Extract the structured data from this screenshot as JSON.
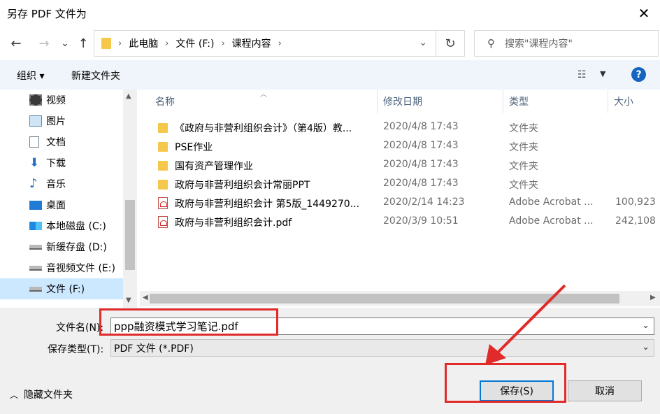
{
  "window": {
    "title": "另存 PDF 文件为",
    "close_symbol": "✕"
  },
  "nav": {
    "back_symbol": "←",
    "forward_symbol": "→",
    "recent_symbol": "⌄",
    "up_symbol": "↑",
    "breadcrumbs": [
      "此电脑",
      "文件 (F:)",
      "课程内容"
    ],
    "crumb_separator": "›",
    "refresh_symbol": "↻",
    "search_placeholder": "搜索\"课程内容\""
  },
  "toolbar": {
    "organize": "组织 ▾",
    "new_folder": "新建文件夹",
    "help": "?"
  },
  "sidebar": {
    "items": [
      {
        "label": "视频",
        "icon": "video-icon"
      },
      {
        "label": "图片",
        "icon": "pictures-icon"
      },
      {
        "label": "文档",
        "icon": "documents-icon"
      },
      {
        "label": "下载",
        "icon": "download-icon"
      },
      {
        "label": "音乐",
        "icon": "music-icon"
      },
      {
        "label": "桌面",
        "icon": "desktop-icon"
      },
      {
        "label": "本地磁盘 (C:)",
        "icon": "windows-drive-icon"
      },
      {
        "label": "新缓存盘 (D:)",
        "icon": "drive-icon"
      },
      {
        "label": "音视频文件 (E:)",
        "icon": "drive-icon"
      },
      {
        "label": "文件 (F:)",
        "icon": "drive-icon",
        "selected": true
      }
    ]
  },
  "columns": {
    "name": "名称",
    "date": "修改日期",
    "type": "类型",
    "size": "大小"
  },
  "files": [
    {
      "name": "《政府与非营利组织会计》（第4版）教...",
      "date": "2020/4/8 17:43",
      "type": "文件夹",
      "size": "",
      "kind": "folder"
    },
    {
      "name": "PSE作业",
      "date": "2020/4/8 17:43",
      "type": "文件夹",
      "size": "",
      "kind": "folder"
    },
    {
      "name": "国有资产管理作业",
      "date": "2020/4/8 17:43",
      "type": "文件夹",
      "size": "",
      "kind": "folder"
    },
    {
      "name": "政府与非营利组织会计常丽PPT",
      "date": "2020/4/8 17:43",
      "type": "文件夹",
      "size": "",
      "kind": "folder"
    },
    {
      "name": "政府与非营利组织会计  第5版_1449270...",
      "date": "2020/2/14 14:23",
      "type": "Adobe Acrobat ...",
      "size": "100,923",
      "kind": "pdf"
    },
    {
      "name": "政府与非营利组织会计.pdf",
      "date": "2020/3/9 10:51",
      "type": "Adobe Acrobat ...",
      "size": "242,108",
      "kind": "pdf"
    }
  ],
  "form": {
    "filename_label": "文件名(N):",
    "filename_value": "ppp融资模式学习笔记.pdf",
    "filetype_label": "保存类型(T):",
    "filetype_value": "PDF 文件 (*.PDF)"
  },
  "footer": {
    "hide_folders": "隐藏文件夹",
    "save": "保存(S)",
    "cancel": "取消"
  },
  "colors": {
    "annotation_red": "#e12b2b",
    "selection": "#cce8ff",
    "accent": "#0078d7"
  }
}
